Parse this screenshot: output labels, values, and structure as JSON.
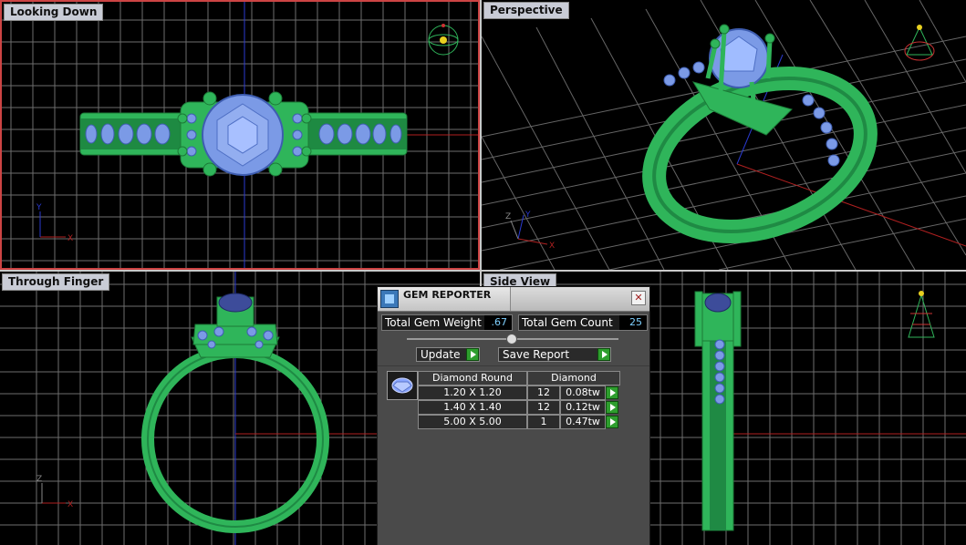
{
  "viewports": {
    "top_left": {
      "label": "Looking Down"
    },
    "top_right": {
      "label": "Perspective"
    },
    "bottom_left": {
      "label": "Through Finger"
    },
    "bottom_right": {
      "label": "Side View"
    }
  },
  "axes": {
    "x": "X",
    "y": "Y",
    "z": "Z"
  },
  "gem_reporter": {
    "title": "GEM REPORTER",
    "close_glyph": "✕",
    "total_weight_label": "Total Gem Weight",
    "total_weight_value": ".67",
    "total_count_label": "Total Gem Count",
    "total_count_value": "25",
    "update_label": "Update",
    "save_report_label": "Save Report",
    "table": {
      "headers": [
        "Diamond Round",
        "Diamond"
      ],
      "rows": [
        {
          "size": "1.20 X 1.20",
          "count": "12",
          "weight": "0.08tw"
        },
        {
          "size": "1.40 X 1.40",
          "count": "12",
          "weight": "0.12tw"
        },
        {
          "size": "5.00 X 5.00",
          "count": "1",
          "weight": "0.47tw"
        }
      ]
    }
  },
  "colors": {
    "viewport_bg": "#000000",
    "grid": "#6e6e6e",
    "metal": "#2fb55a",
    "stone": "#7b9ae6",
    "active_border": "#cc4444"
  },
  "icons": {
    "close": "close-icon",
    "play": "play-arrow-icon",
    "gem_thumbnail": "round-diamond-icon",
    "panel": "gem-reporter-icon"
  }
}
